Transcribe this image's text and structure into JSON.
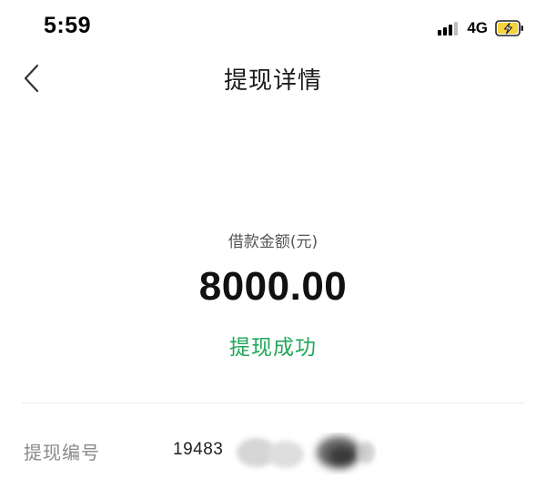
{
  "status_bar": {
    "time": "5:59",
    "network": "4G",
    "signal_icon": "signal-bars-icon",
    "battery_icon": "battery-charging-icon",
    "battery_color": "#f5d33a"
  },
  "nav": {
    "back_icon": "chevron-left-icon",
    "title": "提现详情"
  },
  "amount": {
    "label": "借款金额(元)",
    "value": "8000.00"
  },
  "status": {
    "text": "提现成功",
    "color": "#22a65a"
  },
  "details": [
    {
      "label": "提现编号",
      "value_visible": "19483"
    }
  ]
}
